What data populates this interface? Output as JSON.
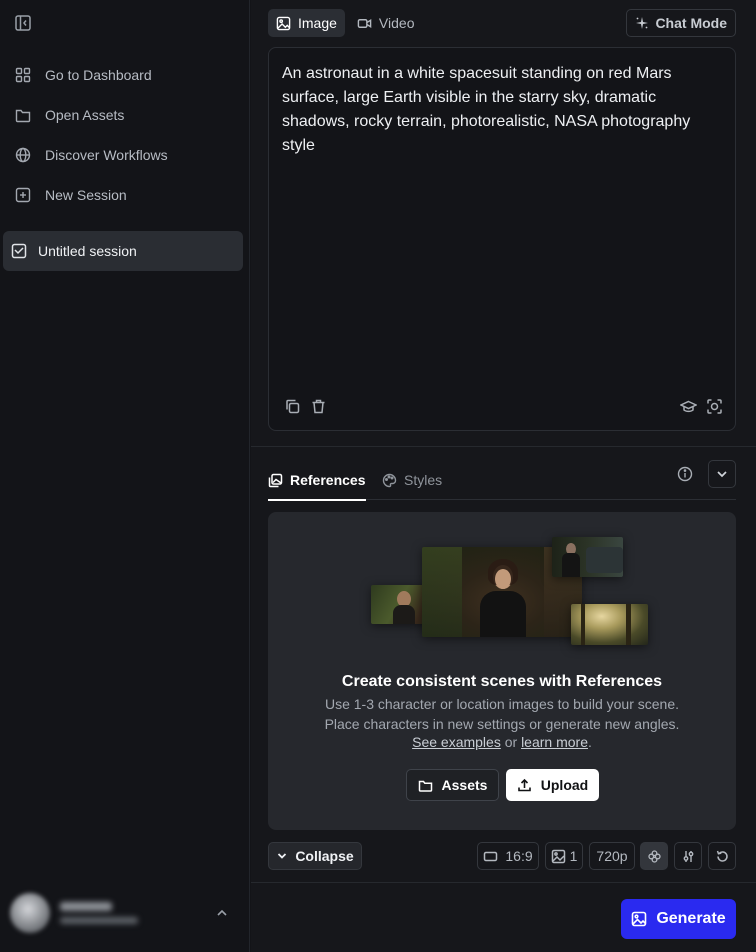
{
  "sidebar": {
    "items": [
      {
        "label": "Go to Dashboard",
        "icon": "grid-icon"
      },
      {
        "label": "Open Assets",
        "icon": "folder-icon"
      },
      {
        "label": "Discover Workflows",
        "icon": "globe-icon"
      },
      {
        "label": "New Session",
        "icon": "plus-square-icon"
      }
    ],
    "active_session": "Untitled session"
  },
  "mode_tabs": [
    {
      "label": "Image",
      "active": true
    },
    {
      "label": "Video",
      "active": false
    }
  ],
  "chat_mode_label": "Chat Mode",
  "prompt": {
    "text": "An astronaut in a white spacesuit standing on red Mars surface, large Earth visible in the starry sky, dramatic shadows, rocky terrain, photorealistic, NASA photography style"
  },
  "ref_tabs": [
    {
      "label": "References",
      "active": true
    },
    {
      "label": "Styles",
      "active": false
    }
  ],
  "references": {
    "title": "Create consistent scenes with References",
    "desc_line1": "Use 1-3 character or location images to build your scene.",
    "desc_line2": "Place characters in new settings or generate new angles.",
    "link_examples": "See examples",
    "link_or": "or",
    "link_learn": "learn more",
    "link_end": ".",
    "assets_label": "Assets",
    "upload_label": "Upload"
  },
  "bottom_bar": {
    "collapse_label": "Collapse",
    "aspect_ratio": "16:9",
    "count": "1",
    "resolution": "720p"
  },
  "generate_label": "Generate",
  "colors": {
    "accent": "#2a2af0",
    "background": "#131418",
    "panel": "#26282d"
  }
}
